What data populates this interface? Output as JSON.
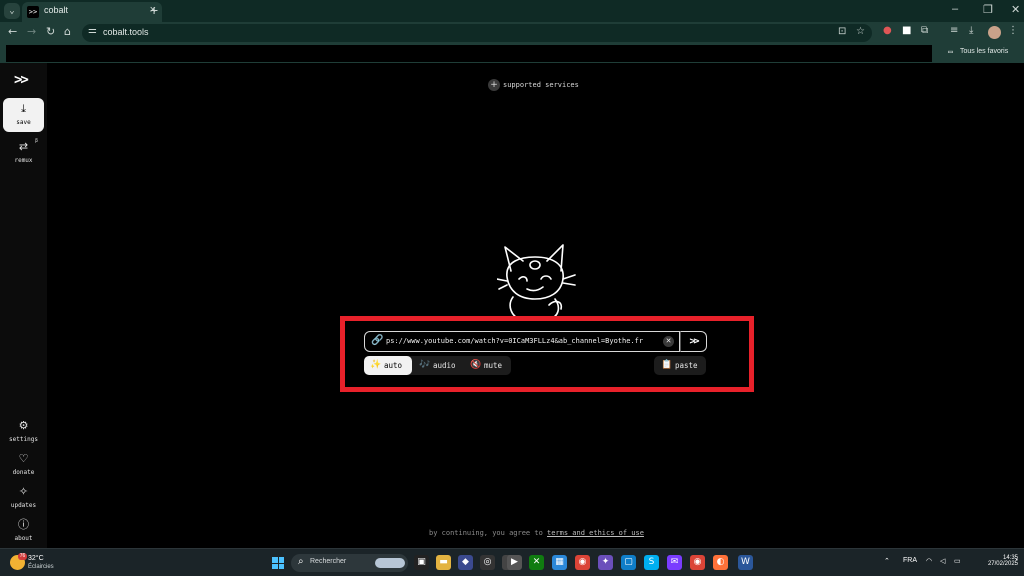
{
  "browser": {
    "tab_title": "cobalt",
    "tab_favicon": ">>",
    "tab_close": "×",
    "new_tab": "+",
    "url": "cobalt.tools",
    "window_controls": {
      "minimize": "–",
      "restore": "❐",
      "close": "✕"
    },
    "bookmarks_all": "Tous les favoris",
    "icons": [
      "back-icon",
      "forward-icon",
      "reload-icon",
      "home-icon",
      "site-settings-icon",
      "install-icon",
      "star-icon",
      "extensions-icon",
      "download-icon",
      "menu-icon"
    ]
  },
  "sidebar": {
    "logo": ">>",
    "items": [
      {
        "label": "save",
        "icon": "⤓",
        "active": true
      },
      {
        "label": "remux",
        "icon": "⇄",
        "badge": "β"
      },
      {
        "label": "settings",
        "icon": "⚙"
      },
      {
        "label": "donate",
        "icon": "♡"
      },
      {
        "label": "updates",
        "icon": "✧"
      },
      {
        "label": "about",
        "icon": "ⓘ"
      }
    ]
  },
  "main": {
    "supported_services": "supported services",
    "url_value": "ps://www.youtube.com/watch?v=0ICaM3FLLz4&ab_channel=Byothe.fr",
    "go_label": ">>",
    "modes": [
      {
        "label": "auto",
        "emoji": "✨",
        "active": true
      },
      {
        "label": "audio",
        "emoji": "🎶"
      },
      {
        "label": "mute",
        "emoji": "🔇"
      }
    ],
    "paste_label": "paste",
    "paste_emoji": "📋",
    "footer_text": "by continuing, you agree to ",
    "footer_link": "terms and ethics of use"
  },
  "taskbar": {
    "weather_temp": "32°C",
    "weather_condition": "Éclaircies",
    "weather_badge": "76",
    "search_placeholder": "Rechercher",
    "language": "FRA",
    "time": "14:35",
    "date": "27/02/2025"
  },
  "colors": {
    "accent_highlight": "#e8212a",
    "chrome_bg": "#1f3d37"
  }
}
